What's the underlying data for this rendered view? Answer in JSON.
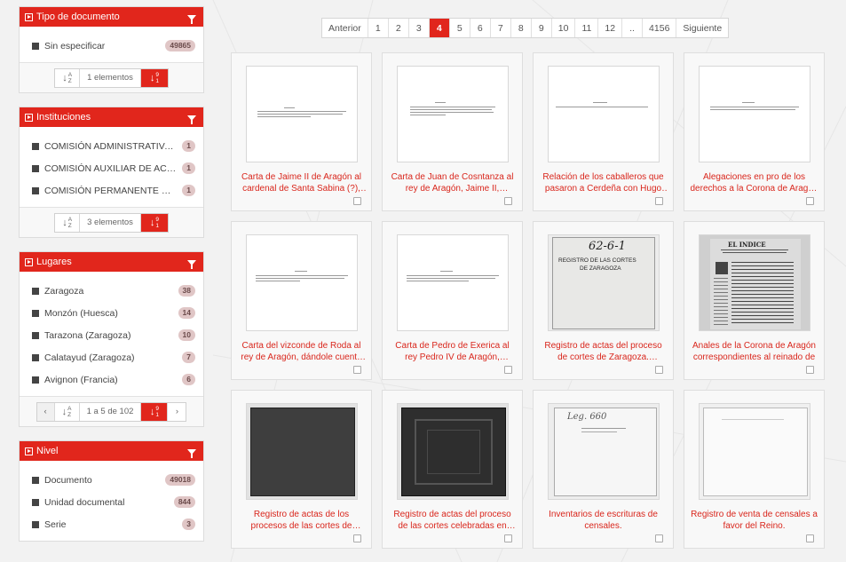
{
  "sidebar": {
    "tipo": {
      "title": "Tipo de documento",
      "items": [
        {
          "label": "Sin especificar",
          "count": "49865"
        }
      ],
      "footer_info": "1 elementos"
    },
    "instituciones": {
      "title": "Instituciones",
      "items": [
        {
          "label": "COMISIÓN ADMINISTRATIVA DE",
          "count": "1"
        },
        {
          "label": "COMISIÓN AUXILIAR DE ACTAS",
          "count": "1"
        },
        {
          "label": "COMISIÓN PERMANENTE DE LA",
          "count": "1"
        }
      ],
      "footer_info": "3 elementos"
    },
    "lugares": {
      "title": "Lugares",
      "items": [
        {
          "label": "Zaragoza",
          "count": "38"
        },
        {
          "label": "Monzón (Huesca)",
          "count": "14"
        },
        {
          "label": "Tarazona (Zaragoza)",
          "count": "10"
        },
        {
          "label": "Calatayud (Zaragoza)",
          "count": "7"
        },
        {
          "label": "Avignon (Francia)",
          "count": "6"
        }
      ],
      "footer_info": "1 a 5 de 102",
      "prev": "‹",
      "next": "›"
    },
    "nivel": {
      "title": "Nivel",
      "items": [
        {
          "label": "Documento",
          "count": "49018"
        },
        {
          "label": "Unidad documental",
          "count": "844"
        },
        {
          "label": "Serie",
          "count": "3"
        }
      ]
    }
  },
  "pagination": {
    "prev": "Anterior",
    "pages": [
      "1",
      "2",
      "3",
      "4",
      "5",
      "6",
      "7",
      "8",
      "9",
      "10",
      "11",
      "12",
      "..",
      "4156"
    ],
    "active": "4",
    "next": "Siguiente"
  },
  "cards": [
    {
      "caption": "Carta de Jaime II de Aragón al cardenal de Santa Sabina (?), sobre",
      "thumb": "text-doc"
    },
    {
      "caption": "Carta de Juan de Cosntanza al rey de Aragón, Jaime II, anunciándole",
      "thumb": "text-doc"
    },
    {
      "caption": "Relación de los caballeros que pasaron a Cerdeña con Hugo de",
      "thumb": "text-doc"
    },
    {
      "caption": "Alegaciones en pro de los derechos a la Corona de Aragón del",
      "thumb": "text-doc"
    },
    {
      "caption": "Carta del vizconde de Roda al rey de Aragón, dándole cuenta de",
      "thumb": "text-doc"
    },
    {
      "caption": "Carta de Pedro de Exerica al rey Pedro IV de Aragón, aconsejándole",
      "thumb": "text-doc"
    },
    {
      "caption": "Registro de actas del proceso de cortes de Zaragoza. Fragmento",
      "thumb": "cover-handwritten"
    },
    {
      "caption": "Anales de la Corona de Aragón correspondientes al reinado de",
      "thumb": "book-page"
    },
    {
      "caption": "Registro de actas de los procesos de las cortes de Caspe,",
      "thumb": "dark-cover"
    },
    {
      "caption": "Registro de actas del proceso de las cortes celebradas en Zaragoza",
      "thumb": "dark-cover-ornate"
    },
    {
      "caption": "Inventarios de escrituras de censales.",
      "thumb": "cover-sketch"
    },
    {
      "caption": "Registro de venta de censales a favor del Reino.",
      "thumb": "faded-page"
    }
  ],
  "thumb_text": {
    "card7_title": "62-6-1",
    "card7_line1": "REGISTRO DE LAS CORTES",
    "card7_line2": "DE ZARAGOZA",
    "card8_title": "EL INDICE",
    "card11_title": "Leg. 660"
  },
  "colors": {
    "accent": "#e1261c",
    "caption": "#d9261c"
  }
}
